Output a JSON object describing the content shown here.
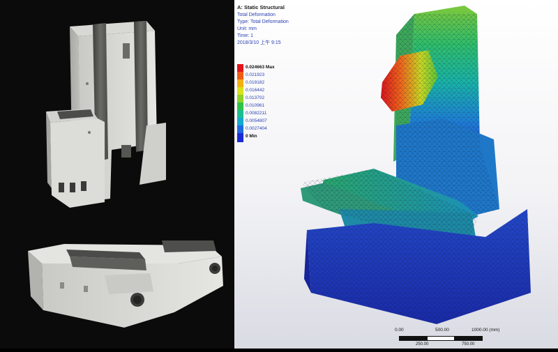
{
  "analysis": {
    "title": "A: Static Structural",
    "result": "Total Deformation",
    "type": "Type: Total Deformation",
    "unit": "Unit: mm",
    "time": "Time: 1",
    "date": "2018/3/10 上午 9:15"
  },
  "legend": {
    "items": [
      {
        "label": "0.024663 Max",
        "color": "#e0141a",
        "bold": true
      },
      {
        "label": "0.021923",
        "color": "#f05a16",
        "bold": false
      },
      {
        "label": "0.019182",
        "color": "#f3b014",
        "bold": false
      },
      {
        "label": "0.016442",
        "color": "#d9e21c",
        "bold": false
      },
      {
        "label": "0.013702",
        "color": "#8fd22a",
        "bold": false
      },
      {
        "label": "0.010961",
        "color": "#2fc24a",
        "bold": false
      },
      {
        "label": "0.0082211",
        "color": "#19bf93",
        "bold": false
      },
      {
        "label": "0.0054807",
        "color": "#14a9cf",
        "bold": false
      },
      {
        "label": "0.0027404",
        "color": "#1f6ae0",
        "bold": false
      },
      {
        "label": "0 Min",
        "color": "#1a2bd6",
        "bold": true
      }
    ]
  },
  "scale": {
    "labels": [
      "0.00",
      "500.00",
      "1000.00 (mm)"
    ],
    "lower_labels": [
      "250.00",
      "750.00"
    ]
  }
}
